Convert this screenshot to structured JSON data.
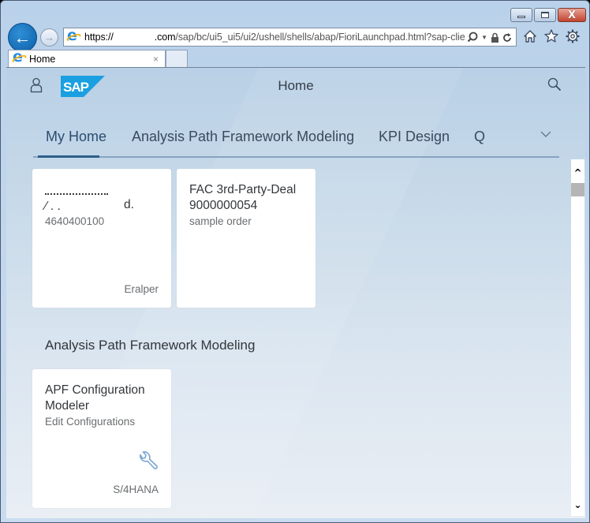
{
  "browser": {
    "caption": {
      "minimize": "minimize",
      "maximize": "maximize",
      "close": "X"
    },
    "address": {
      "scheme": "https://",
      "domain_suffix": ".com",
      "path": "/sap/bc/ui5_ui5/ui2/ushell/shells/abap/FioriLaunchpad.html?sap-clie"
    },
    "tab": {
      "label": "Home",
      "close": "×"
    },
    "colors": {
      "back_button": "#0b5fa8",
      "close_button": "#c0442f"
    }
  },
  "shell": {
    "title": "Home",
    "logo_text": "SAP",
    "colors": {
      "logo": "#1a9fe0",
      "selected_anchor": "#2e5f8a"
    }
  },
  "anchor_bar": {
    "items": [
      {
        "label": "My Home",
        "selected": true
      },
      {
        "label": "Analysis Path Framework Modeling",
        "selected": false
      },
      {
        "label": "KPI Design",
        "selected": false
      },
      {
        "label": "Q",
        "selected": false
      }
    ]
  },
  "my_home": {
    "tiles": [
      {
        "title_redacted_line1": "",
        "title_redacted_line2_suffix": "d.",
        "subtitle": "4640400100",
        "footer": "Eralper"
      },
      {
        "title": "FAC 3rd-Party-Deal 9000000054",
        "subtitle": "sample order",
        "footer": ""
      }
    ]
  },
  "groups": [
    {
      "title": "Analysis Path Framework Modeling",
      "tiles": [
        {
          "title": "APF Configuration Modeler",
          "subtitle": "Edit Configurations",
          "icon": "wrench-icon",
          "footer": "S/4HANA"
        }
      ]
    }
  ]
}
